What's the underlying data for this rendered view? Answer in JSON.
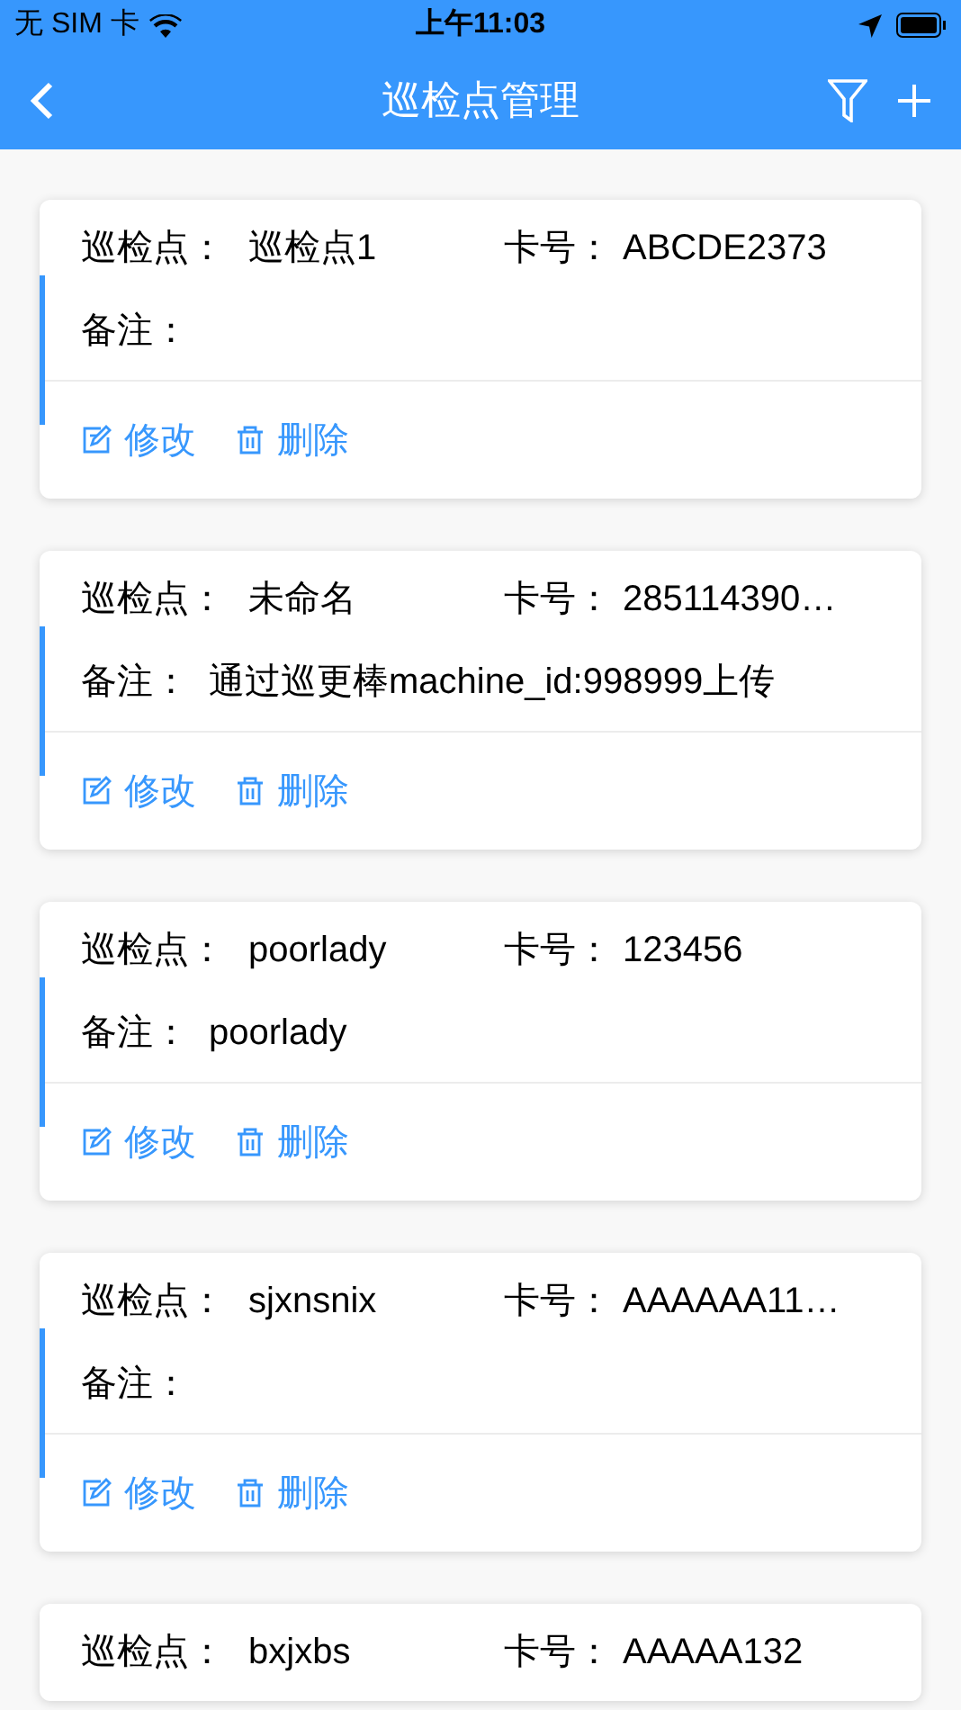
{
  "status_bar": {
    "carrier": "无 SIM 卡",
    "time": "上午11:03"
  },
  "nav": {
    "title": "巡检点管理"
  },
  "cards": [
    {
      "point_label": "巡检点：",
      "point": "巡检点1",
      "card_label": "卡号：",
      "card_no": "ABCDE2373",
      "note_label": "备注：",
      "edit": "修改",
      "delete": "删除"
    },
    {
      "point_label": "巡检点：",
      "point": "未命名",
      "card_label": "卡号：",
      "card_no": "285114390…",
      "note_label": "备注：",
      "note": "通过巡更棒machine_id:998999上传",
      "edit": "修改",
      "delete": "删除"
    },
    {
      "point_label": "巡检点：",
      "point": "poorlady",
      "card_label": "卡号：",
      "card_no": "123456",
      "note_label": "备注：",
      "note": "poorlady",
      "edit": "修改",
      "delete": "删除"
    },
    {
      "point_label": "巡检点：",
      "point": "sjxnsnix",
      "card_label": "卡号：",
      "card_no": "AAAAAA11…",
      "note_label": "备注：",
      "edit": "修改",
      "delete": "删除"
    },
    {
      "point_label": "巡检点：",
      "point": "bxjxbs",
      "card_label": "卡号：",
      "card_no": "AAAAA132"
    }
  ]
}
